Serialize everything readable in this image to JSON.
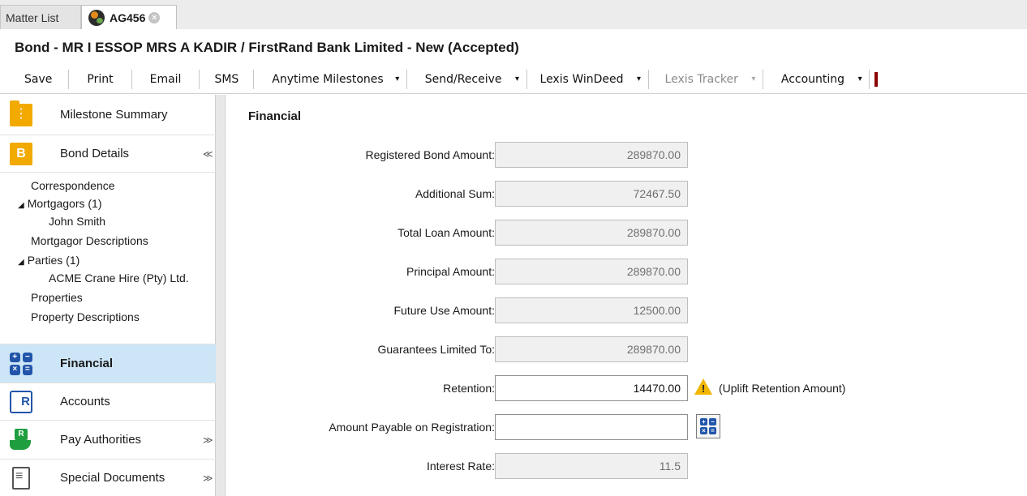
{
  "tabs": {
    "matter_list": "Matter List",
    "active": "AG456",
    "close_glyph": "×"
  },
  "header": {
    "title": "Bond - MR I ESSOP  MRS A KADIR / FirstRand Bank Limited - New  (Accepted)"
  },
  "toolbar": {
    "save": "Save",
    "print": "Print",
    "email": "Email",
    "sms": "SMS",
    "anytime_milestones": "Anytime Milestones",
    "send_receive": "Send/Receive",
    "lexis_windeed": "Lexis WinDeed",
    "lexis_tracker": "Lexis Tracker",
    "accounting": "Accounting",
    "dropdown_glyph": "▾"
  },
  "sidebar": {
    "milestone_summary": "Milestone Summary",
    "bond_details": "Bond Details",
    "bond_chevron": "≈",
    "tree": {
      "correspondence": "Correspondence",
      "mortgagors": "Mortgagors (1)",
      "john_smith": "John Smith",
      "mortgagor_descriptions": "Mortgagor Descriptions",
      "parties": "Parties (1)",
      "acme": "ACME Crane Hire (Pty) Ltd.",
      "properties": "Properties",
      "property_descriptions": "Property Descriptions",
      "expand_glyph": "◢"
    },
    "financial": "Financial",
    "accounts": "Accounts",
    "pay_authorities": "Pay Authorities",
    "special_documents": "Special Documents",
    "expand_chevron": "≫",
    "collapse_chevron": "≪",
    "b_letter": "B",
    "accounts_letter": "R"
  },
  "main": {
    "section_title": "Financial",
    "fields": {
      "registered_bond_amount": {
        "label": "Registered Bond Amount:",
        "value": "289870.00"
      },
      "additional_sum": {
        "label": "Additional Sum:",
        "value": "72467.50"
      },
      "total_loan_amount": {
        "label": "Total Loan Amount:",
        "value": "289870.00"
      },
      "principal_amount": {
        "label": "Principal Amount:",
        "value": "289870.00"
      },
      "future_use_amount": {
        "label": "Future Use Amount:",
        "value": "12500.00"
      },
      "guarantees_limited_to": {
        "label": "Guarantees Limited To:",
        "value": "289870.00"
      },
      "retention": {
        "label": "Retention:",
        "value": "14470.00",
        "note": "(Uplift Retention Amount)"
      },
      "amount_payable": {
        "label": "Amount Payable on Registration:",
        "value": ""
      },
      "interest_rate": {
        "label": "Interest Rate:",
        "value": "11.5"
      }
    }
  },
  "calc_symbols": {
    "plus": "+",
    "minus": "−",
    "times": "×",
    "equals": "="
  },
  "colors": {
    "accent_blue": "#2255aa",
    "folder_orange": "#f2a900",
    "selected_bg": "#cde6f7",
    "warning": "#f2b600",
    "pay_green": "#1e9e3e"
  }
}
